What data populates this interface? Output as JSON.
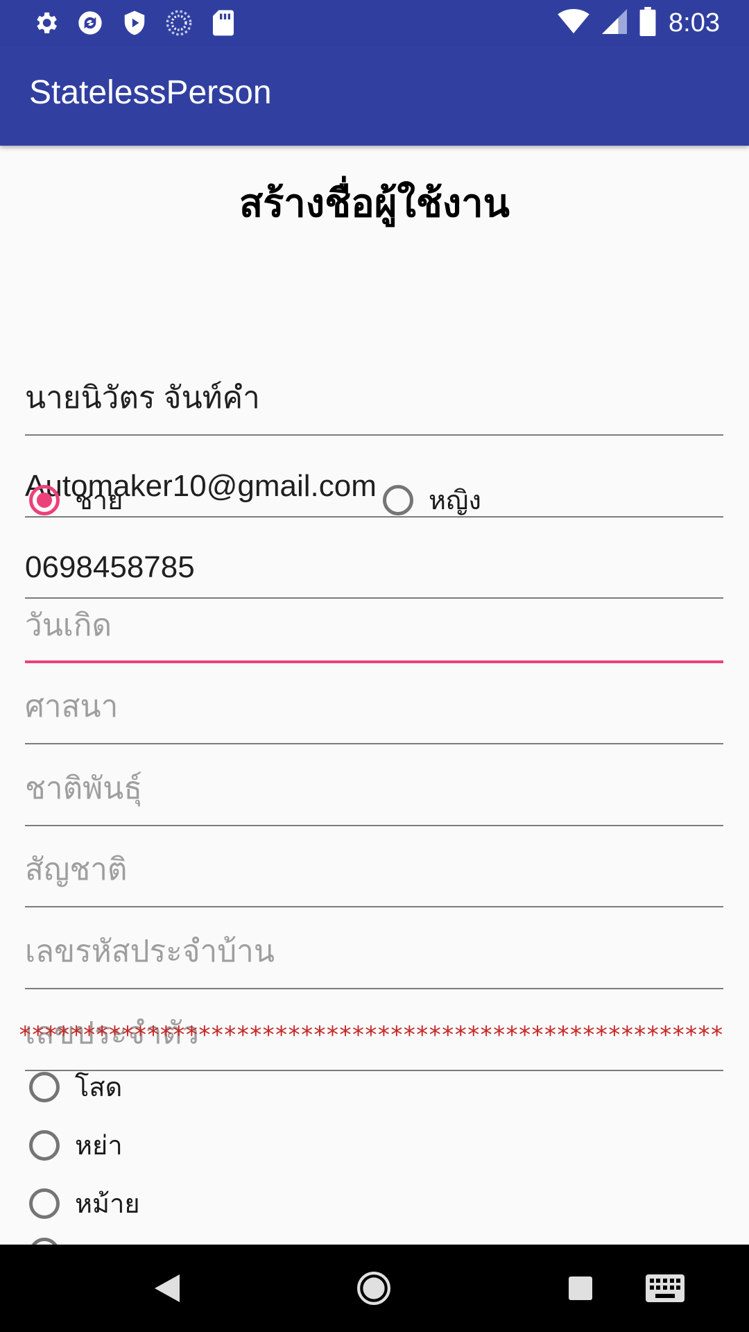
{
  "status_bar": {
    "time": "8:03",
    "left_icons": [
      "settings-icon",
      "sync-icon",
      "play-protect-icon",
      "loading-icon",
      "sd-card-icon"
    ],
    "right_icons": [
      "wifi-icon",
      "signal-icon",
      "battery-icon"
    ]
  },
  "app_bar": {
    "title": "StatelessPerson"
  },
  "form": {
    "title": "สร้างชื่อผู้ใช้งาน",
    "name_value": "นายนิวัตร จันท์คำ",
    "email_value": "Automaker10@gmail.com",
    "phone_value": "0698458785",
    "gender": {
      "male_label": "ชาย",
      "female_label": "หญิง",
      "selected": "male"
    },
    "birthday_placeholder": "วันเกิด",
    "religion_placeholder": "ศาสนา",
    "race_placeholder": "ชาติพันธุ์",
    "nationality_placeholder": "สัญชาติ",
    "house_id_placeholder": "เลขรหัสประจำบ้าน",
    "id_number_placeholder": "เลขประจำตัว",
    "separator": "*******************************************************",
    "marital": {
      "single_label": "โสด",
      "divorced_label": "หย่า",
      "widowed_label": "หม้าย"
    }
  },
  "colors": {
    "primary": "#3140a0",
    "status_bar": "#303f9f",
    "accent": "#ec407a",
    "separator": "#c62828"
  },
  "nav_bar": {
    "icons": [
      "back-icon",
      "home-icon",
      "recents-icon",
      "keyboard-icon"
    ]
  }
}
